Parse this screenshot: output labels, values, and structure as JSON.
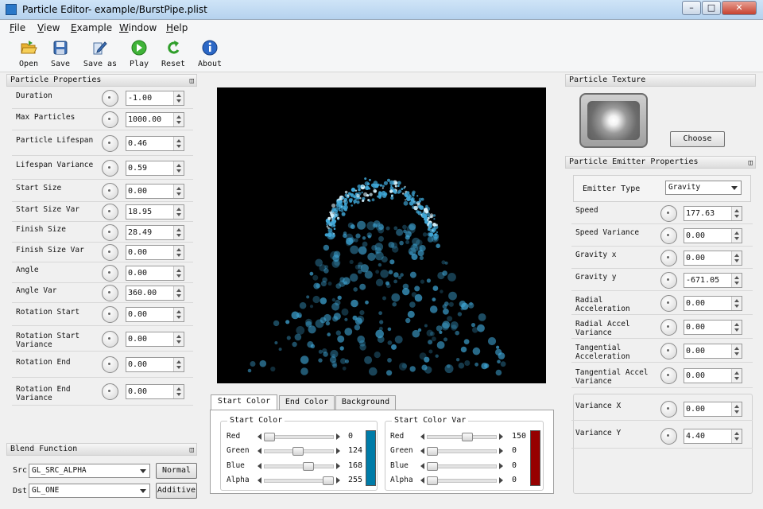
{
  "window": {
    "title": "Particle Editor- example/BurstPipe.plist"
  },
  "menu": [
    "File",
    "View",
    "Example",
    "Window",
    "Help"
  ],
  "toolbar": [
    {
      "label": "Open",
      "icon": "folder-open-icon"
    },
    {
      "label": "Save",
      "icon": "save-icon"
    },
    {
      "label": "Save as",
      "icon": "save-as-icon"
    },
    {
      "label": "Play",
      "icon": "play-icon"
    },
    {
      "label": "Reset",
      "icon": "reset-icon"
    },
    {
      "label": "About",
      "icon": "info-icon"
    }
  ],
  "particle_properties": {
    "title": "Particle Properties",
    "rows": [
      {
        "label": "Duration",
        "value": "-1.00"
      },
      {
        "label": "Max Particles",
        "value": "1000.00"
      },
      {
        "label": "Particle Lifespan",
        "value": "0.46"
      },
      {
        "label": "Lifespan Variance",
        "value": "0.59"
      },
      {
        "label": "Start Size",
        "value": "0.00"
      },
      {
        "label": "Start Size Var",
        "value": "18.95"
      },
      {
        "label": "Finish Size",
        "value": "28.49"
      },
      {
        "label": "Finish Size Var",
        "value": "0.00"
      },
      {
        "label": "Angle",
        "value": "0.00"
      },
      {
        "label": "Angle Var",
        "value": "360.00"
      },
      {
        "label": "Rotation Start",
        "value": "0.00"
      },
      {
        "label": "Rotation Start Variance",
        "value": "0.00"
      },
      {
        "label": "Rotation End",
        "value": "0.00"
      },
      {
        "label": "Rotation End Variance",
        "value": "0.00"
      }
    ]
  },
  "blend_function": {
    "title": "Blend Function",
    "src_label": "Src",
    "src_value": "GL_SRC_ALPHA",
    "dst_label": "Dst",
    "dst_value": "GL_ONE",
    "normal_label": "Normal",
    "additive_label": "Additive"
  },
  "color_tabs": {
    "tabs": [
      "Start Color",
      "End Color",
      "Background"
    ],
    "active_tab": "Start Color",
    "start_color": {
      "title": "Start Color",
      "channels": [
        {
          "label": "Red",
          "value": "0"
        },
        {
          "label": "Green",
          "value": "124"
        },
        {
          "label": "Blue",
          "value": "168"
        },
        {
          "label": "Alpha",
          "value": "255"
        }
      ],
      "swatch": "#007ca8"
    },
    "start_color_var": {
      "title": "Start Color Var",
      "channels": [
        {
          "label": "Red",
          "value": "150"
        },
        {
          "label": "Green",
          "value": "0"
        },
        {
          "label": "Blue",
          "value": "0"
        },
        {
          "label": "Alpha",
          "value": "0"
        }
      ],
      "swatch": "#960000"
    }
  },
  "particle_texture": {
    "title": "Particle Texture",
    "choose_label": "Choose"
  },
  "emitter_properties": {
    "title": "Particle Emitter Properties",
    "emitter_type_label": "Emitter Type",
    "emitter_type_value": "Gravity",
    "rows": [
      {
        "label": "Speed",
        "value": "177.63"
      },
      {
        "label": "Speed Variance",
        "value": "0.00"
      },
      {
        "label": "Gravity x",
        "value": "0.00"
      },
      {
        "label": "Gravity y",
        "value": "-671.05"
      },
      {
        "label": "Radial Acceleration",
        "value": "0.00"
      },
      {
        "label": "Radial Accel Variance",
        "value": "0.00"
      },
      {
        "label": "Tangential Acceleration",
        "value": "0.00"
      },
      {
        "label": "Tangential Accel Variance",
        "value": "0.00"
      }
    ],
    "variance": [
      {
        "label": "Variance X",
        "value": "0.00"
      },
      {
        "label": "Variance Y",
        "value": "4.40"
      }
    ]
  }
}
